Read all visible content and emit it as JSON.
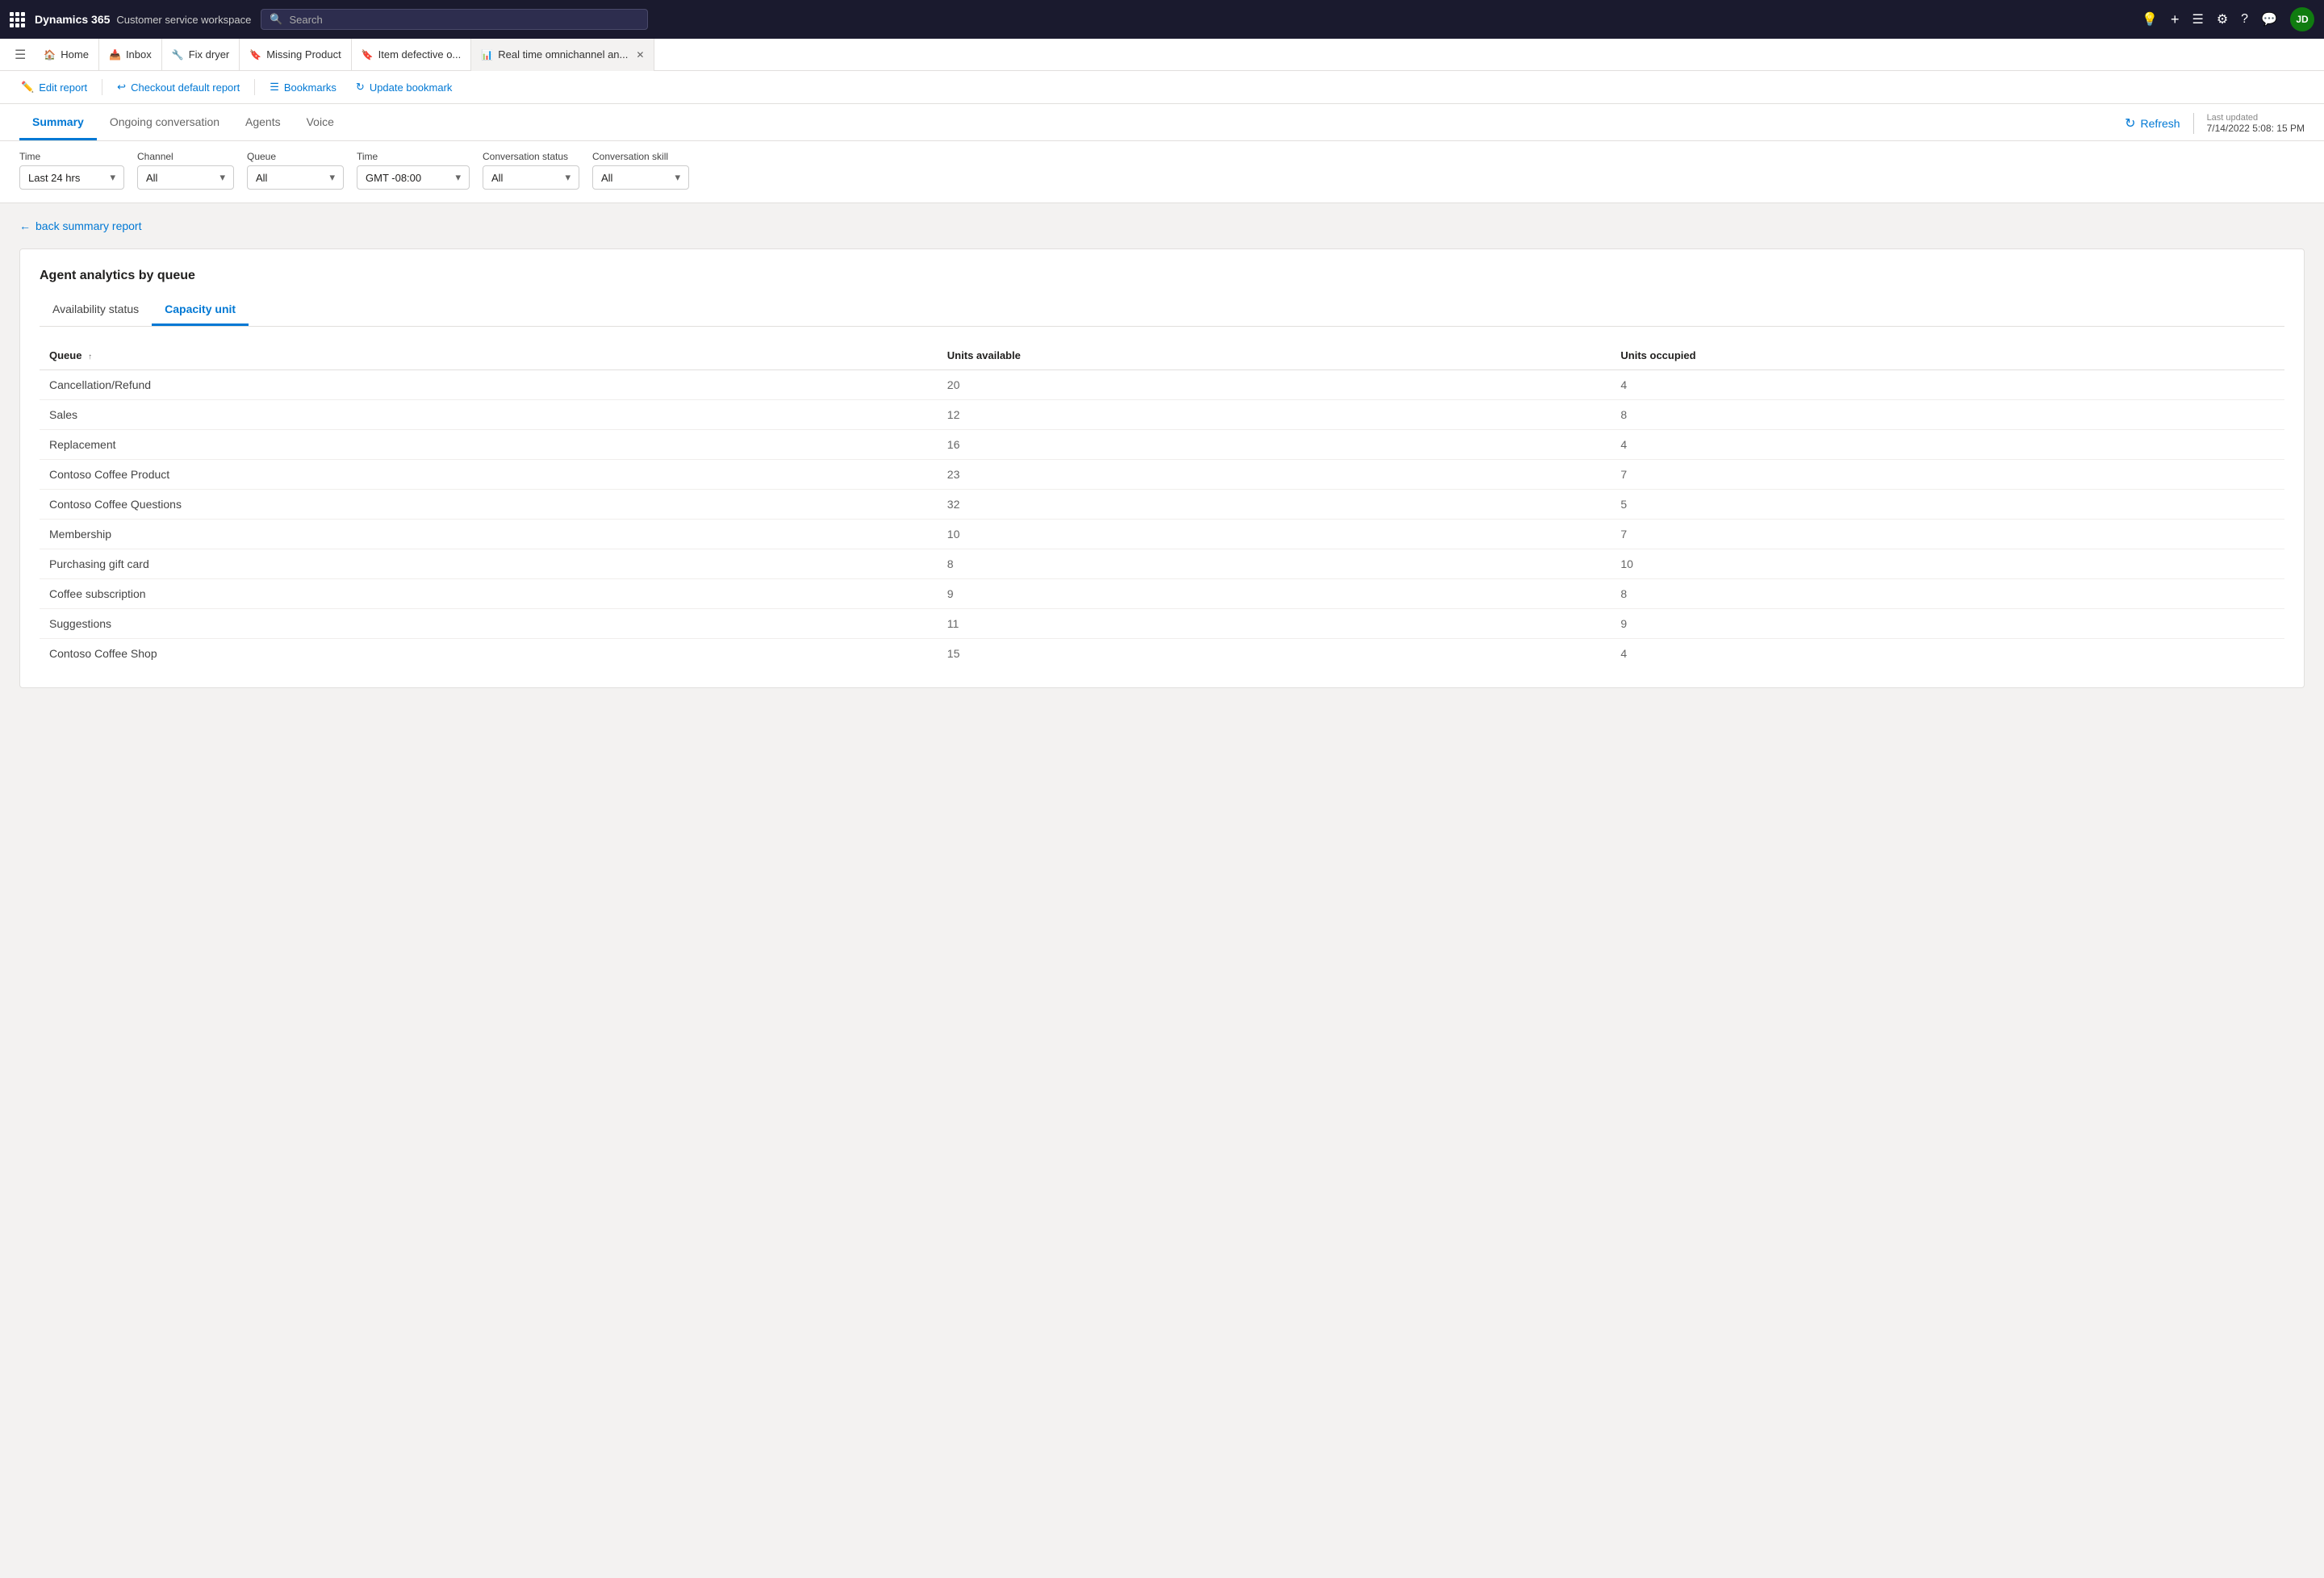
{
  "topbar": {
    "grid_icon": "⊞",
    "brand": "Dynamics 365",
    "app_name": "Customer service workspace",
    "search_placeholder": "Search"
  },
  "tabs": [
    {
      "id": "home",
      "label": "Home",
      "icon": "🏠",
      "closable": false
    },
    {
      "id": "inbox",
      "label": "Inbox",
      "icon": "📥",
      "closable": false
    },
    {
      "id": "fix-dryer",
      "label": "Fix dryer",
      "icon": "🔧",
      "closable": false
    },
    {
      "id": "missing-product",
      "label": "Missing Product",
      "icon": "🔖",
      "closable": false
    },
    {
      "id": "item-defective",
      "label": "Item defective o...",
      "icon": "🔖",
      "closable": false
    },
    {
      "id": "realtime",
      "label": "Real time omnichannel an...",
      "icon": "📊",
      "closable": true,
      "active": true
    }
  ],
  "toolbar": {
    "edit_report": "Edit report",
    "checkout_default": "Checkout default report",
    "bookmarks": "Bookmarks",
    "update_bookmark": "Update bookmark"
  },
  "subtabs": [
    {
      "id": "summary",
      "label": "Summary",
      "active": true
    },
    {
      "id": "ongoing",
      "label": "Ongoing conversation"
    },
    {
      "id": "agents",
      "label": "Agents"
    },
    {
      "id": "voice",
      "label": "Voice"
    }
  ],
  "refresh": {
    "label": "Refresh",
    "last_updated_label": "Last updated",
    "last_updated_value": "7/14/2022 5:08: 15 PM"
  },
  "filters": [
    {
      "id": "time",
      "label": "Time",
      "value": "Last 24 hrs"
    },
    {
      "id": "channel",
      "label": "Channel",
      "value": "All"
    },
    {
      "id": "queue",
      "label": "Queue",
      "value": "All"
    },
    {
      "id": "time2",
      "label": "Time",
      "value": "GMT -08:00"
    },
    {
      "id": "conv_status",
      "label": "Conversation status",
      "value": "All"
    },
    {
      "id": "conv_skill",
      "label": "Conversation skill",
      "value": "All"
    }
  ],
  "back_link": "back summary report",
  "card": {
    "title": "Agent analytics by queue",
    "inner_tabs": [
      {
        "id": "availability",
        "label": "Availability status"
      },
      {
        "id": "capacity",
        "label": "Capacity unit",
        "active": true
      }
    ],
    "table": {
      "columns": [
        {
          "id": "queue",
          "label": "Queue",
          "sortable": true
        },
        {
          "id": "units_available",
          "label": "Units available"
        },
        {
          "id": "units_occupied",
          "label": "Units occupied"
        }
      ],
      "rows": [
        {
          "queue": "Cancellation/Refund",
          "units_available": "20",
          "units_occupied": "4"
        },
        {
          "queue": "Sales",
          "units_available": "12",
          "units_occupied": "8"
        },
        {
          "queue": "Replacement",
          "units_available": "16",
          "units_occupied": "4"
        },
        {
          "queue": "Contoso Coffee Product",
          "units_available": "23",
          "units_occupied": "7"
        },
        {
          "queue": "Contoso Coffee Questions",
          "units_available": "32",
          "units_occupied": "5"
        },
        {
          "queue": "Membership",
          "units_available": "10",
          "units_occupied": "7"
        },
        {
          "queue": "Purchasing gift card",
          "units_available": "8",
          "units_occupied": "10"
        },
        {
          "queue": "Coffee subscription",
          "units_available": "9",
          "units_occupied": "8"
        },
        {
          "queue": "Suggestions",
          "units_available": "11",
          "units_occupied": "9"
        },
        {
          "queue": "Contoso Coffee Shop",
          "units_available": "15",
          "units_occupied": "4"
        }
      ]
    }
  }
}
